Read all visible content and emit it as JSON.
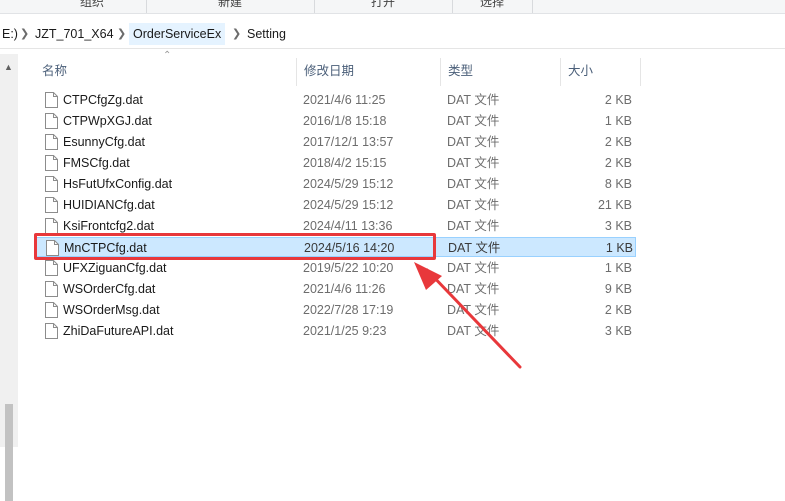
{
  "ribbon": {
    "groups": [
      "组织",
      "新建",
      "打开",
      "选择"
    ]
  },
  "address": {
    "prefix": "E:)",
    "crumbs": [
      "JZT_701_X64",
      "OrderServiceEx",
      "Setting"
    ]
  },
  "columns": {
    "name": "名称",
    "date": "修改日期",
    "type": "类型",
    "size": "大小"
  },
  "files": [
    {
      "name": "CTPCfgZg.dat",
      "date": "2021/4/6 11:25",
      "type": "DAT 文件",
      "size": "2 KB"
    },
    {
      "name": "CTPWpXGJ.dat",
      "date": "2016/1/8 15:18",
      "type": "DAT 文件",
      "size": "1 KB"
    },
    {
      "name": "EsunnyCfg.dat",
      "date": "2017/12/1 13:57",
      "type": "DAT 文件",
      "size": "2 KB"
    },
    {
      "name": "FMSCfg.dat",
      "date": "2018/4/2 15:15",
      "type": "DAT 文件",
      "size": "2 KB"
    },
    {
      "name": "HsFutUfxConfig.dat",
      "date": "2024/5/29 15:12",
      "type": "DAT 文件",
      "size": "8 KB"
    },
    {
      "name": "HUIDIANCfg.dat",
      "date": "2024/5/29 15:12",
      "type": "DAT 文件",
      "size": "21 KB"
    },
    {
      "name": "KsiFrontcfg2.dat",
      "date": "2024/4/11 13:36",
      "type": "DAT 文件",
      "size": "3 KB"
    },
    {
      "name": "MnCTPCfg.dat",
      "date": "2024/5/16 14:20",
      "type": "DAT 文件",
      "size": "1 KB"
    },
    {
      "name": "UFXZiguanCfg.dat",
      "date": "2019/5/22 10:20",
      "type": "DAT 文件",
      "size": "1 KB"
    },
    {
      "name": "WSOrderCfg.dat",
      "date": "2021/4/6 11:26",
      "type": "DAT 文件",
      "size": "9 KB"
    },
    {
      "name": "WSOrderMsg.dat",
      "date": "2022/7/28 17:19",
      "type": "DAT 文件",
      "size": "2 KB"
    },
    {
      "name": "ZhiDaFutureAPI.dat",
      "date": "2021/1/25 9:23",
      "type": "DAT 文件",
      "size": "3 KB"
    }
  ],
  "selected_file": "MnCTPCfg.dat",
  "colors": {
    "selection_bg": "#cce8ff",
    "selection_border": "#99d1ff",
    "annotation": "#e8383b",
    "header_text": "#4c607a"
  },
  "icons": {
    "file": "blank-file-icon",
    "separator": "chevron-right-icon",
    "sort": "sort-up-icon",
    "scroll_up": "scroll-up-arrow-icon"
  }
}
